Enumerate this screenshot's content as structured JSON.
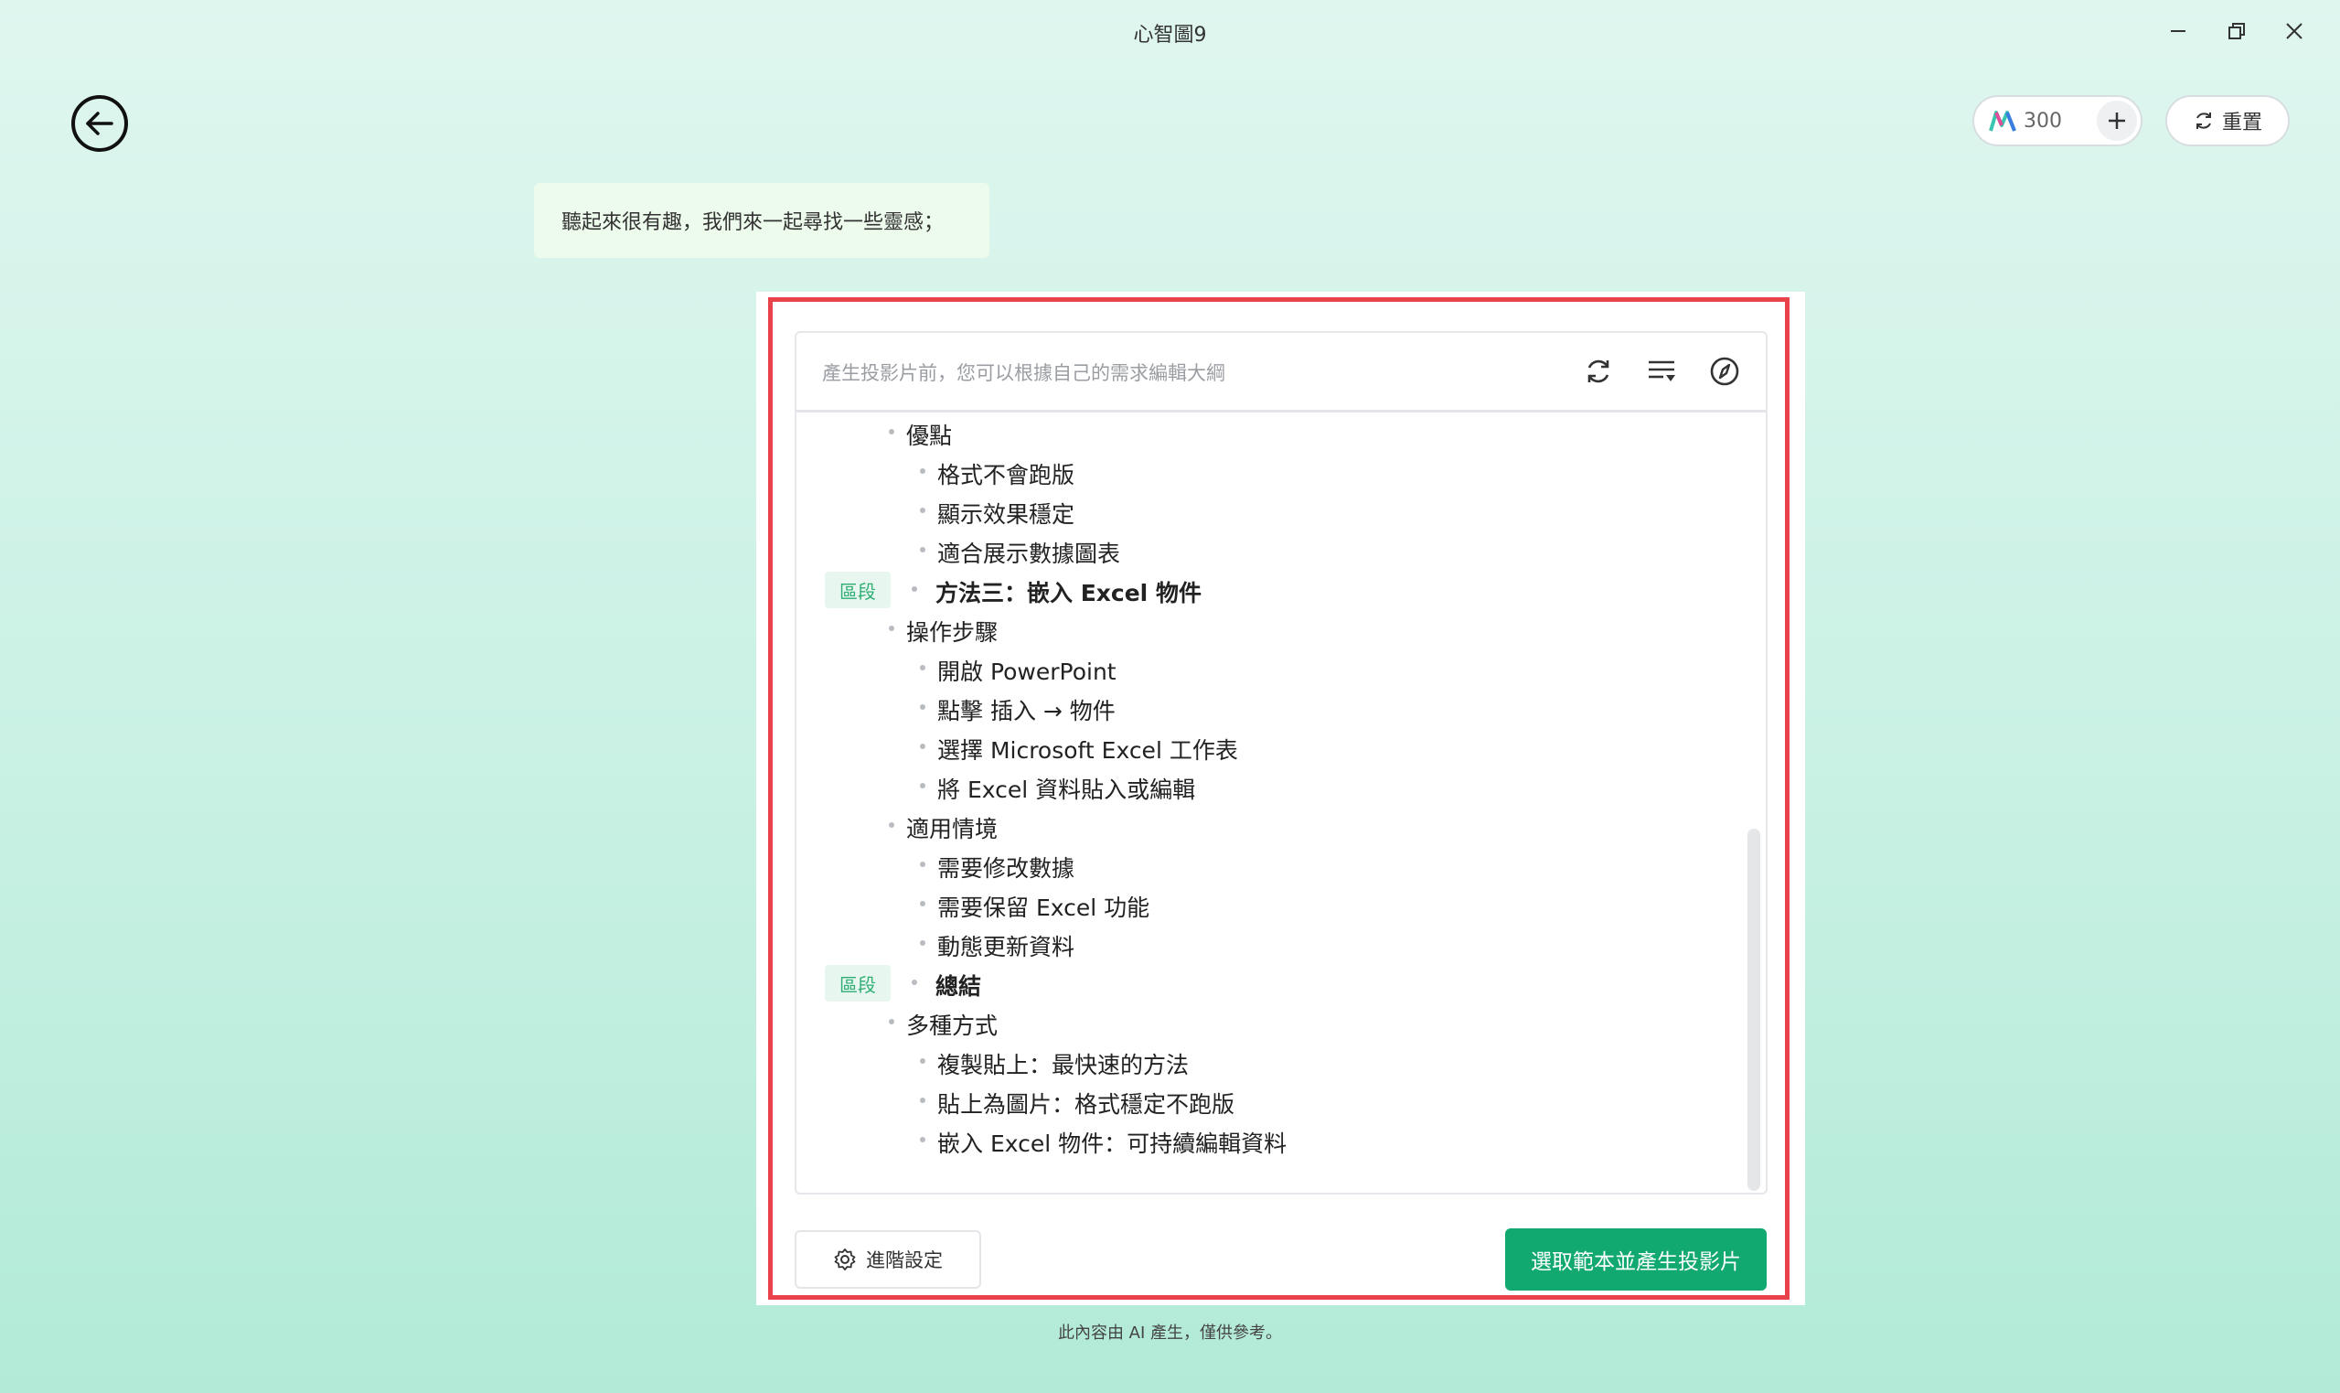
{
  "window": {
    "title": "心智圖9"
  },
  "credits": {
    "count": "300"
  },
  "reset_label": "重置",
  "chat": {
    "message": "聽起來很有趣，我們來一起尋找一些靈感；"
  },
  "editor": {
    "hint": "產生投影片前，您可以根據自己的需求編輯大綱",
    "section_tag": "區段",
    "outline": [
      {
        "level": 1,
        "text": "優點",
        "section": false
      },
      {
        "level": 2,
        "text": "格式不會跑版",
        "section": false
      },
      {
        "level": 2,
        "text": "顯示效果穩定",
        "section": false
      },
      {
        "level": 2,
        "text": "適合展示數據圖表",
        "section": false
      },
      {
        "level": 0,
        "text": "方法三：嵌入 Excel 物件",
        "section": true
      },
      {
        "level": 1,
        "text": "操作步驟",
        "section": false
      },
      {
        "level": 2,
        "text": "開啟 PowerPoint",
        "section": false
      },
      {
        "level": 2,
        "text": "點擊 插入 → 物件",
        "section": false
      },
      {
        "level": 2,
        "text": "選擇 Microsoft Excel 工作表",
        "section": false
      },
      {
        "level": 2,
        "text": "將 Excel 資料貼入或編輯",
        "section": false
      },
      {
        "level": 1,
        "text": "適用情境",
        "section": false
      },
      {
        "level": 2,
        "text": "需要修改數據",
        "section": false
      },
      {
        "level": 2,
        "text": "需要保留 Excel 功能",
        "section": false
      },
      {
        "level": 2,
        "text": "動態更新資料",
        "section": false
      },
      {
        "level": 0,
        "text": "總結",
        "section": true
      },
      {
        "level": 1,
        "text": "多種方式",
        "section": false
      },
      {
        "level": 2,
        "text": "複製貼上：最快速的方法",
        "section": false
      },
      {
        "level": 2,
        "text": "貼上為圖片：格式穩定不跑版",
        "section": false
      },
      {
        "level": 2,
        "text": "嵌入 Excel 物件：可持續編輯資料",
        "section": false
      }
    ]
  },
  "buttons": {
    "advanced_settings": "進階設定",
    "generate": "選取範本並產生投影片"
  },
  "footer": {
    "note": "此內容由 AI 產生，僅供參考。"
  },
  "colors": {
    "accent_green": "#11a970",
    "highlight_red": "#e8434a",
    "section_tag_bg": "#e7f7ef",
    "section_tag_text": "#2fae74"
  }
}
